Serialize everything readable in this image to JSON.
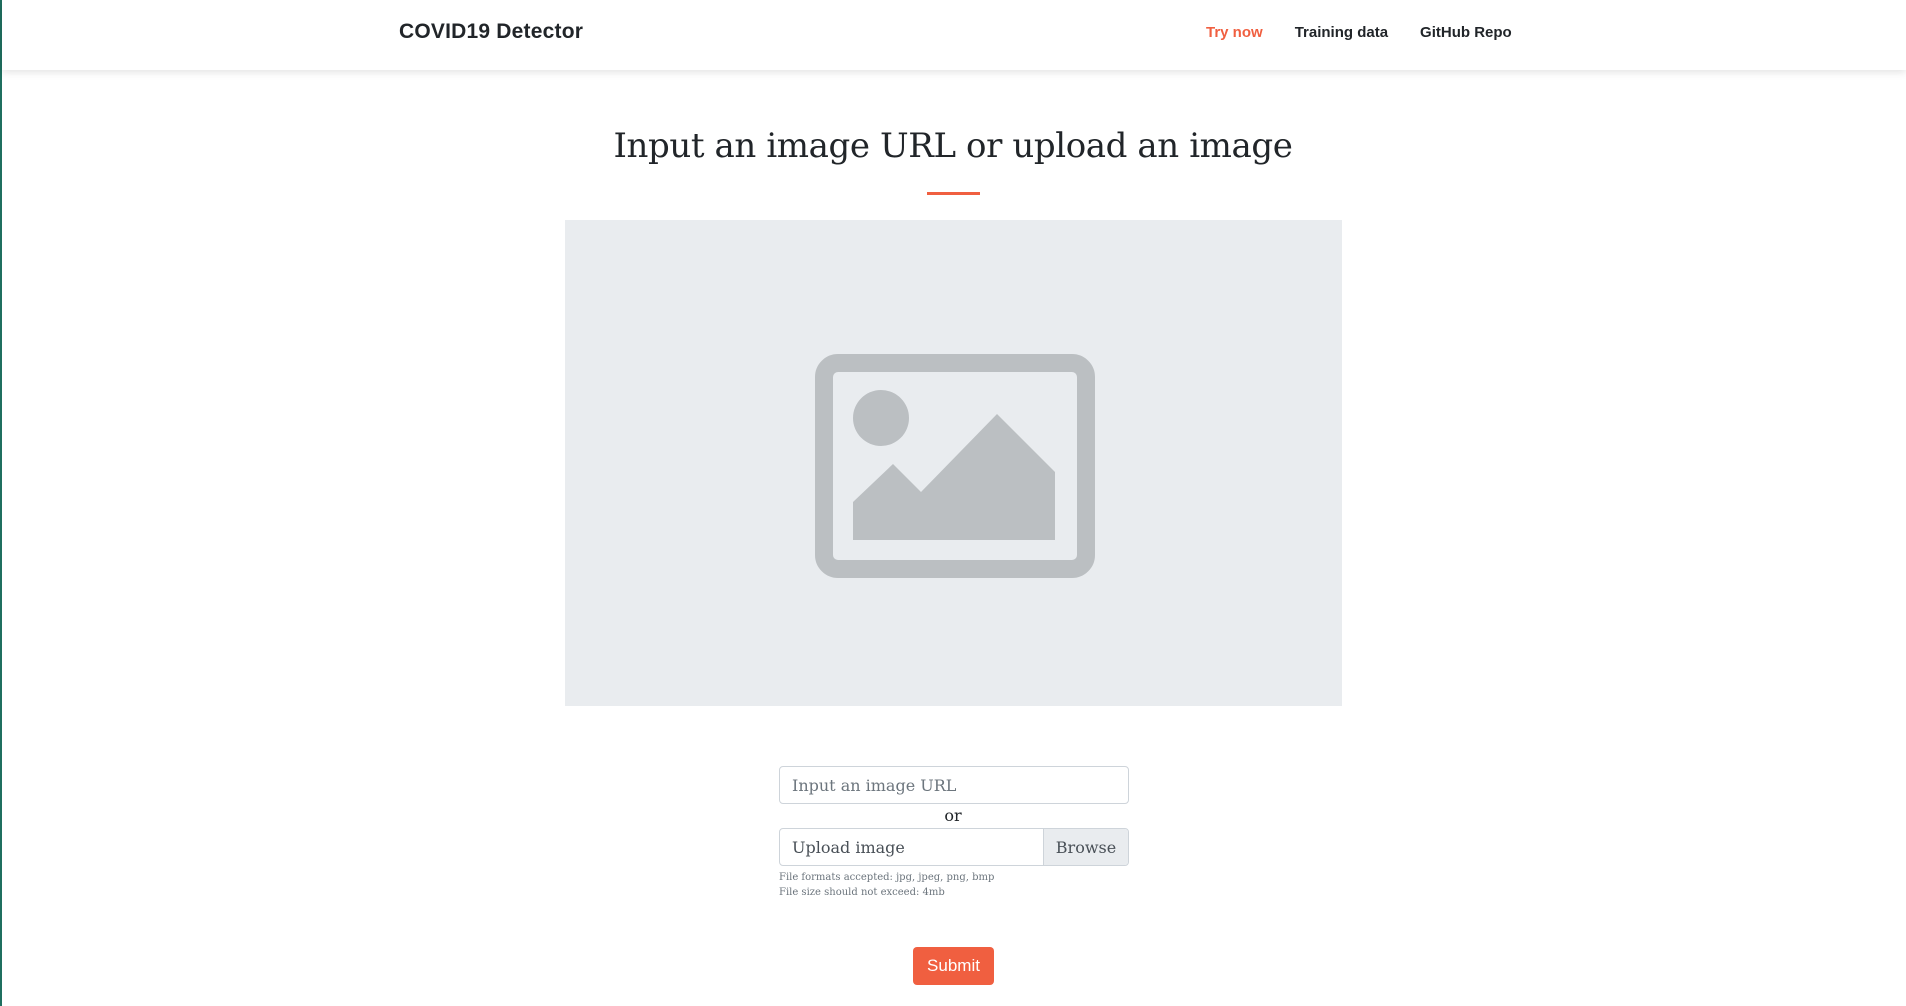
{
  "navbar": {
    "brand": "COVID19 Detector",
    "links": [
      {
        "label": "Try now",
        "active": true
      },
      {
        "label": "Training data",
        "active": false
      },
      {
        "label": "GitHub Repo",
        "active": false
      }
    ]
  },
  "main": {
    "title": "Input an image URL or upload an image",
    "preview_icon": "image-placeholder-icon",
    "url_input": {
      "placeholder": "Input an image URL",
      "value": ""
    },
    "or_text": "or",
    "file_upload": {
      "label": "Upload image",
      "button_label": "Browse"
    },
    "help": {
      "formats": "File formats accepted: jpg, jpeg, png, bmp",
      "size": "File size should not exceed: 4mb"
    },
    "submit_label": "Submit"
  },
  "colors": {
    "accent": "#f05f40",
    "preview_bg": "#e9ecef",
    "placeholder_icon": "#bbbfc2"
  }
}
